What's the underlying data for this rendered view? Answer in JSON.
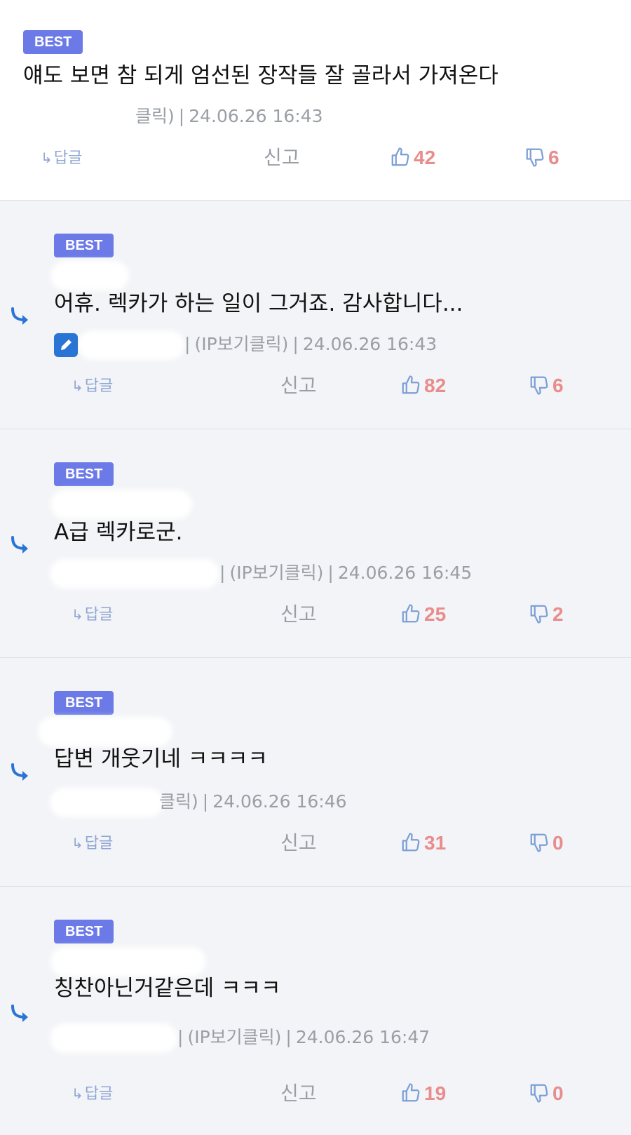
{
  "labels": {
    "best": "BEST",
    "reply": "답글",
    "report": "신고",
    "ip_suffix": "(IP보기클릭)"
  },
  "colors": {
    "badge": "#6c7ae8",
    "count": "#e88c8c",
    "thumb": "#7c9fd6",
    "reply_arrow": "#2a74d6",
    "reply_bg": "#f3f4f7"
  },
  "comments": [
    {
      "text": "얘도 보면 참 되게 엄선된 장작들 잘 골라서 가져온다",
      "author_tail": "클릭)",
      "date": "24.06.26 16:43",
      "likes": "42",
      "dislikes": "6"
    },
    {
      "text": "어휴. 렉카가 하는 일이 그거죠. 감사합니다...",
      "author_tail": "(IP보기클릭)",
      "date": "24.06.26 16:43",
      "likes": "82",
      "dislikes": "6"
    },
    {
      "text": "A급 렉카로군.",
      "author_tail": "(IP보기클릭)",
      "date": "24.06.26 16:45",
      "likes": "25",
      "dislikes": "2"
    },
    {
      "text": "답변 개웃기네 ㅋㅋㅋㅋ",
      "author_tail": "클릭)",
      "date": "24.06.26 16:46",
      "likes": "31",
      "dislikes": "0"
    },
    {
      "text": "칭찬아닌거같은데 ㅋㅋㅋ",
      "author_tail": "(IP보기클릭)",
      "date": "24.06.26 16:47",
      "likes": "19",
      "dislikes": "0"
    }
  ]
}
